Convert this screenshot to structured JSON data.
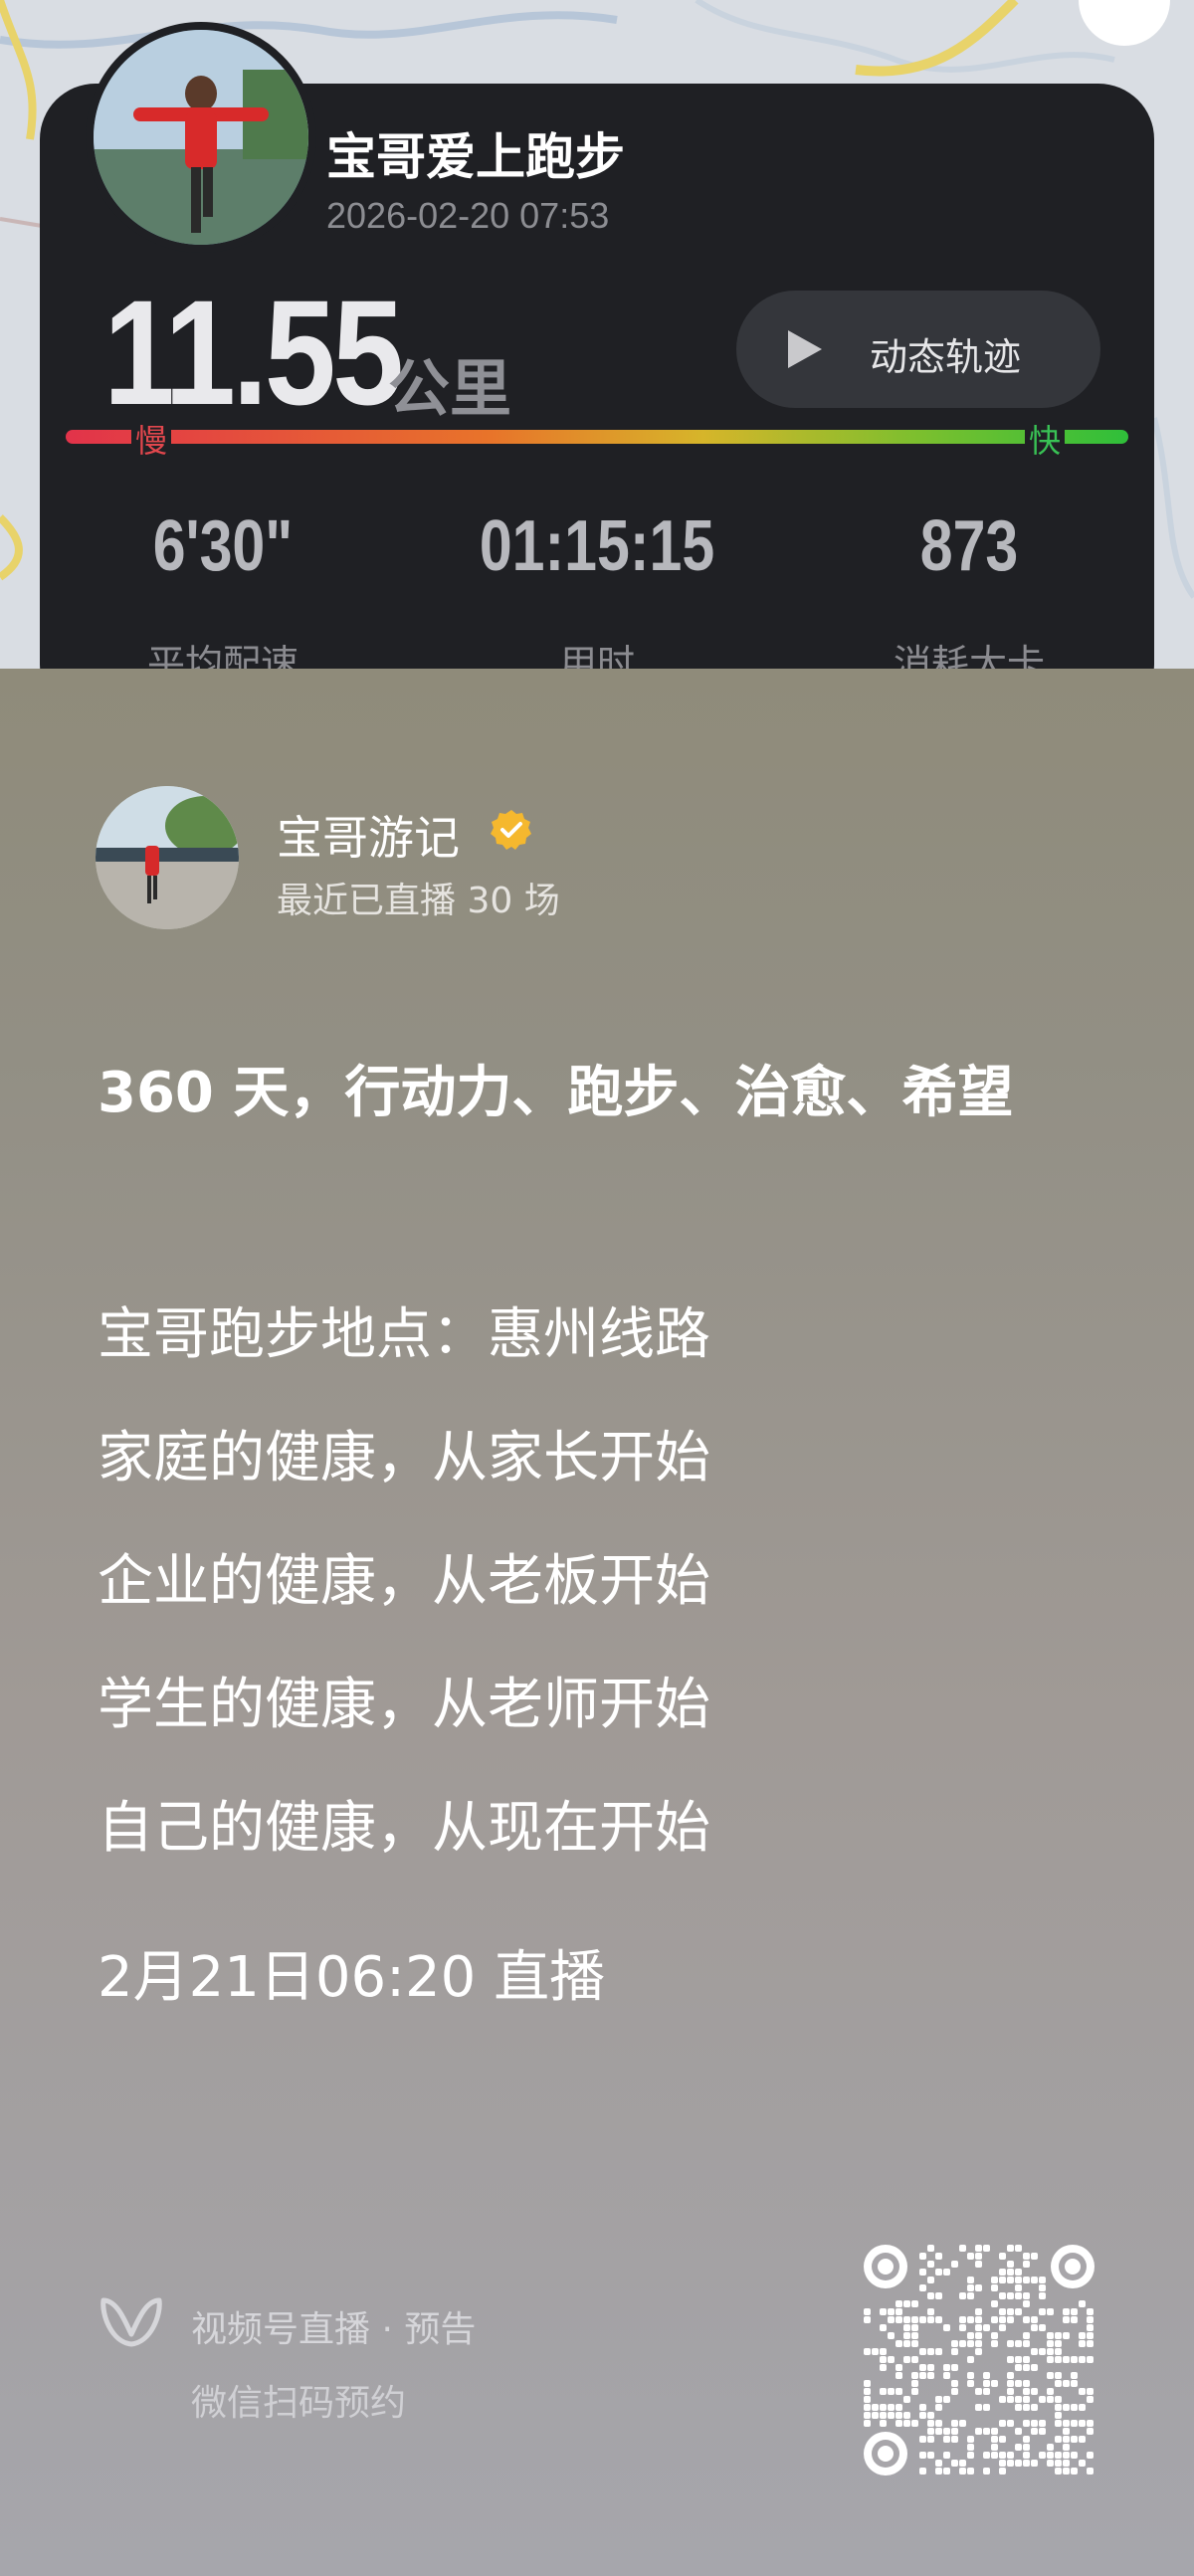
{
  "run_card": {
    "runner_name": "宝哥爱上跑步",
    "run_datetime": "2026-02-20 07:53",
    "distance_value": "11.55",
    "distance_unit": "公里",
    "track_button_label": "动态轨迹",
    "pace_slow_label": "慢",
    "pace_fast_label": "快",
    "stats": [
      {
        "value": "6'30\"",
        "label": "平均配速"
      },
      {
        "value": "01:15:15",
        "label": "用时"
      },
      {
        "value": "873",
        "label": "消耗大卡"
      }
    ]
  },
  "author": {
    "name": "宝哥游记",
    "subtitle": "最近已直播 30 场",
    "verified_color": "#f5b82e"
  },
  "post": {
    "title": "360 天，行动力、跑步、治愈、希望",
    "lines": [
      "宝哥跑步地点：惠州线路",
      "家庭的健康，从家长开始",
      "企业的健康，从老板开始",
      "学生的健康，从老师开始",
      "自己的健康，从现在开始"
    ],
    "live_time": "2月21日06:20 直播"
  },
  "footer": {
    "title": "视频号直播 · 预告",
    "subtitle": "微信扫码预约"
  },
  "colors": {
    "card_bg": "#1f2024",
    "pace_slow": "#e2474d",
    "pace_fast": "#39c255"
  },
  "icons": [
    "play-icon",
    "verified-icon",
    "channels-logo-icon",
    "qr-code"
  ]
}
